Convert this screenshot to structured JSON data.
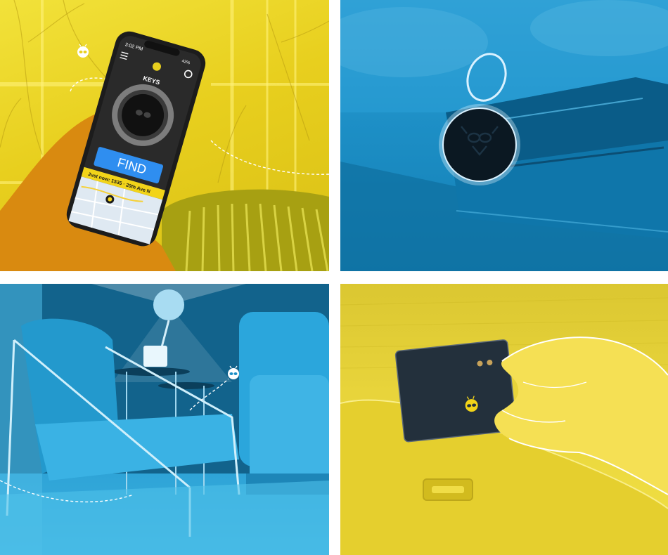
{
  "panels": {
    "top_left": {
      "phone": {
        "status_time": "3:02 PM",
        "status_battery": "42%",
        "item_label": "KEYS",
        "find_button_label": "FIND",
        "location_text": "Just now: 1535 · 20th Ave N"
      }
    }
  },
  "colors": {
    "yellow": "#e8cf1e",
    "blue": "#1d8fc6",
    "white": "#ffffff",
    "dark": "#1b2733"
  },
  "icons": [
    "pebblebee-logo-icon",
    "menu-icon",
    "settings-icon",
    "map-pin-icon",
    "signal-dashed-path-icon"
  ]
}
